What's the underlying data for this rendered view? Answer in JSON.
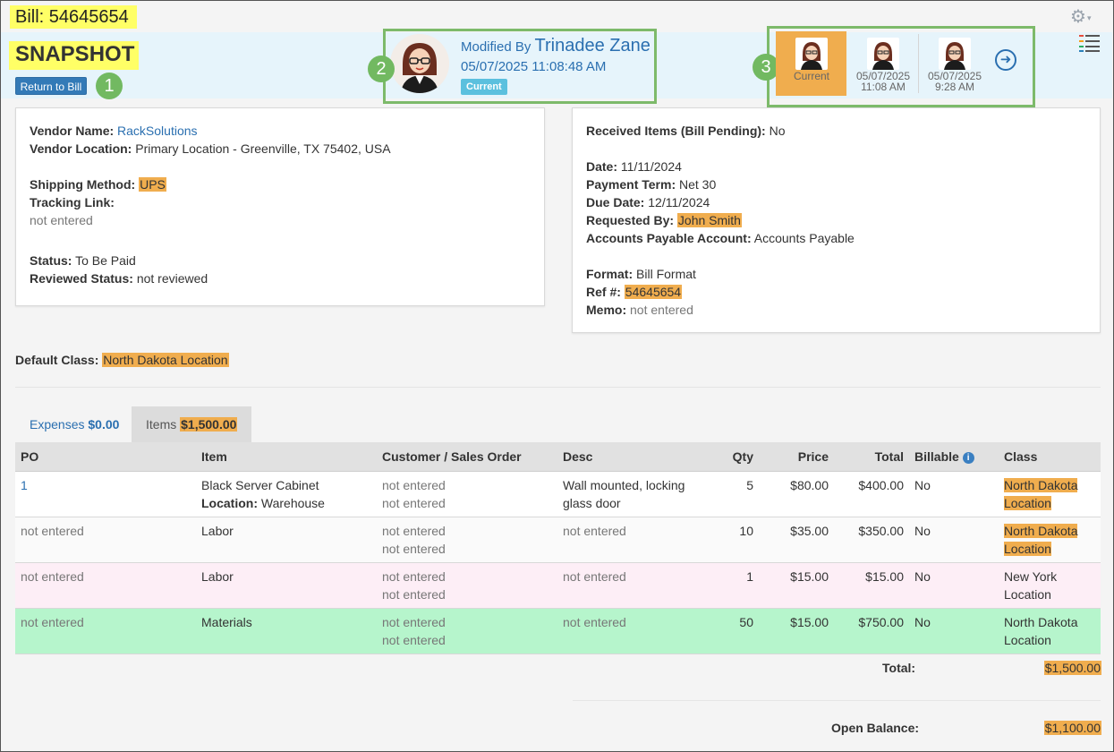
{
  "header": {
    "bill_title": "Bill: 54645654",
    "settings_caret": "▾"
  },
  "snapshot": {
    "title": "SNAPSHOT",
    "return_button": "Return to Bill",
    "callouts": [
      "1",
      "2",
      "3"
    ],
    "modified_by_label": "Modified By",
    "modified_by_name": "Trinadee Zane",
    "modified_datetime": "05/07/2025 11:08:48 AM",
    "current_badge": "Current",
    "versions": [
      {
        "label": "Current",
        "date": "",
        "time": "",
        "selected": true
      },
      {
        "label": "",
        "date": "05/07/2025",
        "time": "11:08 AM",
        "selected": false
      },
      {
        "label": "",
        "date": "05/07/2025",
        "time": "9:28 AM",
        "selected": false
      }
    ],
    "next_icon": "arrow-right-circle-icon"
  },
  "left_panel": {
    "vendor_name_label": "Vendor Name:",
    "vendor_name": "RackSolutions",
    "vendor_location_label": "Vendor Location:",
    "vendor_location": "Primary Location - Greenville, TX 75402, USA",
    "shipping_method_label": "Shipping Method:",
    "shipping_method": "UPS",
    "tracking_link_label": "Tracking Link:",
    "tracking_link": "not entered",
    "status_label": "Status:",
    "status": "To Be Paid",
    "reviewed_status_label": "Reviewed Status:",
    "reviewed_status": "not reviewed"
  },
  "right_panel": {
    "received_label": "Received Items (Bill Pending):",
    "received": "No",
    "date_label": "Date:",
    "date": "11/11/2024",
    "payment_term_label": "Payment Term:",
    "payment_term": "Net 30",
    "due_date_label": "Due Date:",
    "due_date": "12/11/2024",
    "requested_by_label": "Requested By:",
    "requested_by": "John Smith",
    "ap_account_label": "Accounts Payable Account:",
    "ap_account": "Accounts Payable",
    "format_label": "Format:",
    "format": "Bill Format",
    "ref_label": "Ref #:",
    "ref": "54645654",
    "memo_label": "Memo:",
    "memo": "not entered"
  },
  "default_class": {
    "label": "Default Class:",
    "value": "North Dakota Location"
  },
  "tabs": {
    "expenses_label": "Expenses",
    "expenses_amount": "$0.00",
    "items_label": "Items",
    "items_amount": "$1,500.00"
  },
  "table": {
    "headers": {
      "po": "PO",
      "item": "Item",
      "customer": "Customer / Sales Order",
      "desc": "Desc",
      "qty": "Qty",
      "price": "Price",
      "total": "Total",
      "billable": "Billable",
      "class": "Class"
    },
    "rows": [
      {
        "po": "1",
        "item": "Black Server Cabinet",
        "location_label": "Location:",
        "location": "Warehouse",
        "customer": "not entered",
        "sales_order": "not entered",
        "desc": "Wall mounted, locking glass door",
        "qty": "5",
        "price": "$80.00",
        "total": "$400.00",
        "billable": "No",
        "class": "North Dakota Location"
      },
      {
        "po": "not entered",
        "item": "Labor",
        "customer": "not entered",
        "sales_order": "not entered",
        "desc": "not entered",
        "qty": "10",
        "price": "$35.00",
        "total": "$350.00",
        "billable": "No",
        "class": "North Dakota Location"
      },
      {
        "po": "not entered",
        "item": "Labor",
        "customer": "not entered",
        "sales_order": "not entered",
        "desc": "not entered",
        "qty": "1",
        "price": "$15.00",
        "total": "$15.00",
        "billable": "No",
        "class": "New York Location"
      },
      {
        "po": "not entered",
        "item": "Materials",
        "customer": "not entered",
        "sales_order": "not entered",
        "desc": "not entered",
        "qty": "50",
        "price": "$15.00",
        "total": "$750.00",
        "billable": "No",
        "class": "North Dakota Location"
      }
    ]
  },
  "totals": {
    "total_label": "Total:",
    "total": "$1,500.00",
    "open_balance_label": "Open Balance:",
    "open_balance": "$1,100.00"
  },
  "colors": {
    "highlight_orange": "#f0ad4e",
    "highlight_yellow": "#ffff66",
    "callout_green": "#72b961",
    "link_blue": "#2a6fb0",
    "row_pink": "#fdeef6",
    "row_green": "#b6f5cc"
  }
}
